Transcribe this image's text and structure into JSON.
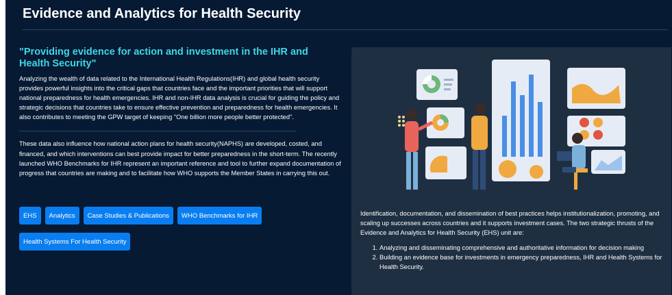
{
  "header": {
    "title": "Evidence and Analytics for Health Security"
  },
  "main": {
    "quote": "\"Providing evidence for action and investment in the IHR and Health Security\"",
    "paragraph1": "Analyzing the wealth of data related to the International Health Regulations(IHR) and global health security provides powerful insights into the critical gaps that countries face and the important priorities that will support national preparedness for health emergencies. IHR and non-IHR data analysis is crucial for guiding the policy and strategic decisions that countries take to ensure effective prevention and preparedness for health emergencies. It also contributes to meeting the GPW target of keeping \"One billion more people better protected\".",
    "paragraph2": "These data also influence how national action plans for health security(NAPHS) are developed, costed, and financed, and which interventions can best provide impact for better preparedness in the short-term. The recently launched WHO Benchmarks for IHR represent an important reference and tool to further expand documentation of progress that countries are making and to facilitate how WHO supports the Member States in carrying this out."
  },
  "buttons": {
    "ehs": "EHS",
    "analytics": "Analytics",
    "case_studies": "Case Studies & Publications",
    "benchmarks": "WHO Benchmarks for IHR",
    "health_systems": "Health Systems For Health Security"
  },
  "panel": {
    "intro": "Identification, documentation, and dissemination of best practices helps institutionalization, promoting, and scaling up successes across countries and it supports investment cases. The two strategic thrusts of the Evidence and Analytics for Health Security (EHS) unit are:",
    "items": [
      "Analyzing and disseminating comprehensive and authoritative information for decision making",
      "Building an evidence base for investments in emergency preparedness, IHR and Health Systems for Health Security."
    ]
  },
  "colors": {
    "background": "#061a33",
    "panel": "#1f2f42",
    "accent": "#3fd6e6",
    "button": "#0a7ef0"
  }
}
